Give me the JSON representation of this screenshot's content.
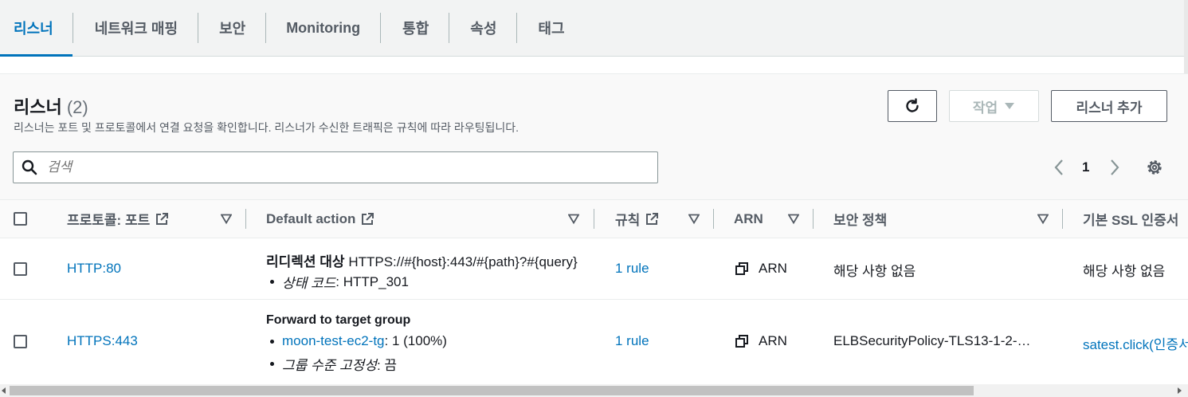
{
  "tabs": [
    {
      "label": "리스너",
      "active": true
    },
    {
      "label": "네트워크 매핑"
    },
    {
      "label": "보안"
    },
    {
      "label": "Monitoring"
    },
    {
      "label": "통합"
    },
    {
      "label": "속성"
    },
    {
      "label": "태그"
    }
  ],
  "listeners": {
    "title": "리스너",
    "count": "(2)",
    "description": "리스너는 포트 및 프로토콜에서 연결 요청을 확인합니다. 리스너가 수신한 트래픽은 규칙에 따라 라우팅됩니다.",
    "action_label": "작업",
    "add_label": "리스너 추가",
    "search_placeholder": "검색",
    "page": "1"
  },
  "columns": {
    "protocol": "프로토콜: 포트",
    "default_action": "Default action",
    "rules": "규칙",
    "arn": "ARN",
    "security_policy": "보안 정책",
    "ssl_cert": "기본 SSL 인증서"
  },
  "rows": [
    {
      "protocol": "HTTP:80",
      "action_title": "리디렉션 대상",
      "action_target": "HTTPS://#{host}:443/#{path}?#{query}",
      "detail_label": "상태 코드",
      "detail_value": ": HTTP_301",
      "rules": "1 rule",
      "arn": "ARN",
      "security_policy": "해당 사항 없음",
      "ssl_cert": "해당 사항 없음"
    },
    {
      "protocol": "HTTPS:443",
      "action_title": "Forward to target group",
      "target_group": "moon-test-ec2-tg",
      "target_weight": ": 1 (100%)",
      "stickiness_label": "그룹 수준 고정성",
      "stickiness_value": ": 끔",
      "rules": "1 rule",
      "arn": "ARN",
      "security_policy": "ELBSecurityPolicy-TLS13-1-2-…",
      "ssl_cert": "satest.click(인증서"
    }
  ],
  "colors": {
    "accent": "#0073bb",
    "text": "#16191f",
    "muted": "#545b64"
  }
}
